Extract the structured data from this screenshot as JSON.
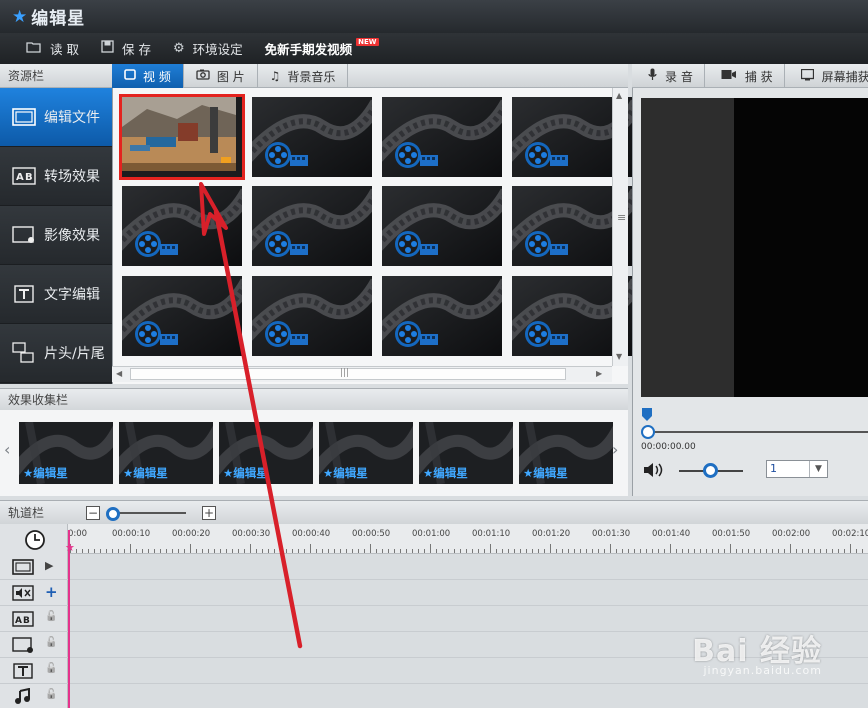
{
  "app": {
    "title": "编辑星"
  },
  "toolbar": {
    "read_label": "读 取",
    "save_label": "保 存",
    "settings_label": "环境设定",
    "free_phone_label": "免新手期发视频",
    "new_badge": "NEW"
  },
  "resource_panel": {
    "title": "资源栏",
    "tabs": [
      {
        "label": "视 频",
        "icon": "video-square-icon",
        "active": true
      },
      {
        "label": "图 片",
        "icon": "camera-icon",
        "active": false
      },
      {
        "label": "背景音乐",
        "icon": "music-note-icon",
        "active": false
      }
    ],
    "side_items": [
      {
        "label": "编辑文件",
        "icon": "film-edit-icon",
        "active": true
      },
      {
        "label": "转场效果",
        "icon": "ab-transition-icon",
        "active": false
      },
      {
        "label": "影像效果",
        "icon": "image-effect-icon",
        "active": false
      },
      {
        "label": "文字编辑",
        "icon": "text-t-icon",
        "active": false
      },
      {
        "label": "片头/片尾",
        "icon": "intro-outro-icon",
        "active": false
      }
    ],
    "thumbnails_count": 12
  },
  "recording": {
    "tabs": [
      {
        "label": "录 音",
        "icon": "microphone-icon"
      },
      {
        "label": "捕 获",
        "icon": "camera-capture-icon"
      },
      {
        "label": "屏幕捕获",
        "icon": "screen-capture-icon"
      }
    ],
    "time": "00:00:00.00",
    "speed_value": "1"
  },
  "effects_bar": {
    "title": "效果收集栏",
    "items": [
      "编辑星",
      "编辑星",
      "编辑星",
      "编辑星",
      "编辑星",
      "编辑星"
    ]
  },
  "track_bar": {
    "title": "轨道栏",
    "ticks": [
      "0:00",
      "00:00:10",
      "00:00:20",
      "00:00:30",
      "00:00:40",
      "00:00:50",
      "00:01:00",
      "00:01:10",
      "00:01:20",
      "00:01:30",
      "00:01:40",
      "00:01:50",
      "00:02:00",
      "00:02:10"
    ]
  },
  "watermark": {
    "main": "Bai 经验",
    "sub": "jingyan.baidu.com"
  },
  "colors": {
    "accent_blue": "#1670c8",
    "selection_red": "#e3231f",
    "arrow_red": "#d8202a",
    "playhead_pink": "#e5338c"
  }
}
